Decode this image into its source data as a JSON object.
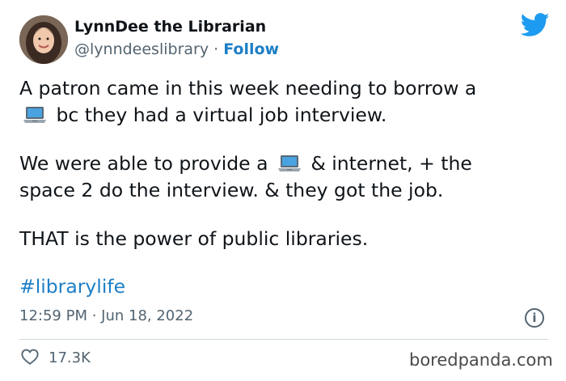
{
  "author": {
    "display_name": "LynnDee the Librarian",
    "handle": "@lynndeeslibrary",
    "separator": "·",
    "follow_label": "Follow"
  },
  "tweet": {
    "p1_a": "A patron came in this week needing to borrow a",
    "p1_b": "bc they had a virtual job interview.",
    "p2_a": "We were able to provide a",
    "p2_b": "& internet, + the",
    "p2_c": "space 2 do the interview. & they got the job.",
    "p3": "THAT is the power of public libraries.",
    "hashtag": "#librarylife"
  },
  "meta": {
    "timestamp": "12:59 PM · Jun 18, 2022",
    "info_symbol": "i"
  },
  "engagement": {
    "likes": "17.3K"
  },
  "watermark": "boredpanda.com",
  "icons": [
    "twitter-bird-icon",
    "laptop-emoji-icon",
    "info-icon",
    "heart-icon"
  ],
  "colors": {
    "link": "#1d7fc6",
    "twitter_blue": "#1d9bf0",
    "secondary_text": "#536471",
    "divider": "#cfd9de"
  }
}
